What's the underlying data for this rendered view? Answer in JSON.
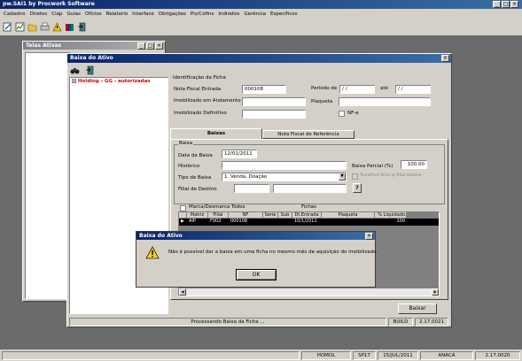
{
  "app": {
    "title": "pw.SAI1 by Procwork Software",
    "menu": [
      "Cadastro",
      "Diretos",
      "Ciap",
      "Guias",
      "Ofícios",
      "Relatorio",
      "Interface",
      "Obrigações",
      "Pis/Cofins",
      "Indiretos",
      "Gerência",
      "Específicos"
    ]
  },
  "telas_ativas": {
    "title": "Telas Ativas"
  },
  "baixa_window": {
    "title": "Baixa do Ativo",
    "tree_item": "Holding - GG - autorizadas",
    "identificacao_label": "Identificação da Ficha",
    "nf_entrada_label": "Nota Fiscal Entrada",
    "nf_entrada_value": "000108",
    "periodo_label": "Período de",
    "periodo_de": "/ /",
    "ate_label": "até",
    "periodo_ate": "/ /",
    "imob_andamento_label": "Imobilizado em Andamento",
    "imob_andamento_value": "",
    "plaqueta_label": "Plaqueta",
    "plaqueta_value": "",
    "imob_definitivo_label": "Imobilizado Definitivo",
    "imob_definitivo_value": "",
    "nfe_label": "NF-e",
    "tabs": [
      "Baixas",
      "Nota Fiscal de Referência"
    ],
    "baixa_group_label": "Baixa",
    "data_baixa_label": "Data da Baixa",
    "data_baixa_value": "12/01/2011",
    "historico_label": "Histórico",
    "historico_value": "",
    "baixa_parcial_label": "Baixa Parcial (%)",
    "baixa_parcial_value": "100,00",
    "transferir_label": "Transferir ficha p/ filial destino",
    "tipo_baixa_label": "Tipo de Baixa",
    "tipo_baixa_value": "1. Venda, Doação",
    "filial_destino_label": "Filial de Destino",
    "filial_destino_value": "",
    "help_btn": "?",
    "marca_label": "Marca/Desmarca Todos",
    "fichas_label": "Fichas",
    "columns": [
      "Matriz",
      "Filial",
      "NF",
      "Serie",
      "Sub",
      "Dt.Entrada",
      "Plaqueta",
      "% Liquidado"
    ],
    "rows": [
      {
        "matriz": "AIP",
        "filial": "F002",
        "nf": "000108",
        "serie": "",
        "sub": "",
        "dt": "10/1/2011",
        "plaqueta": "",
        "liq": "100"
      }
    ],
    "baixar_btn": "Baixar",
    "status_msg": "Processando Baixa da Ficha ...",
    "status_build": "BUILD",
    "status_version": "2.17.0021"
  },
  "dialog": {
    "title": "Baixa do Ativo",
    "message": "Não é possível dar a baixa em uma ficha no mesmo mês de aquisição do imobilizado.",
    "ok_label": "OK"
  },
  "statusbar": {
    "env": "HOMOL",
    "sp": "SP17",
    "date": "15/JUL/2011",
    "user": "ANACA",
    "version": "2.17.0020"
  },
  "colors": {
    "titlebar": "#0a246a",
    "face": "#d4d0c8",
    "desktop": "#6b6b6b",
    "tree_text": "#cc0000",
    "selected_row": "#000000"
  }
}
